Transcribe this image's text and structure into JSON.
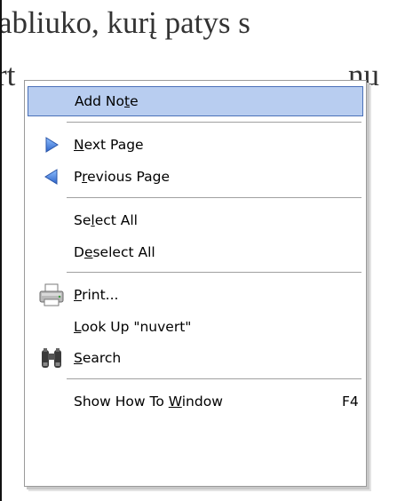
{
  "document": {
    "line1": "abliuko, kurį patys s",
    "line2_prefix": "rt",
    "line2_suffix": "nu"
  },
  "menu": {
    "items": [
      {
        "pre": "Add No",
        "u": "t",
        "post": "e",
        "shortcut": ""
      },
      {
        "pre": "",
        "u": "N",
        "post": "ext Page",
        "shortcut": ""
      },
      {
        "pre": "P",
        "u": "r",
        "post": "evious Page",
        "shortcut": ""
      },
      {
        "pre": "Se",
        "u": "l",
        "post": "ect All",
        "shortcut": ""
      },
      {
        "pre": "D",
        "u": "e",
        "post": "select All",
        "shortcut": ""
      },
      {
        "pre": "",
        "u": "P",
        "post": "rint...",
        "shortcut": ""
      },
      {
        "pre": "",
        "u": "L",
        "post": "ook Up \"nuvert\"",
        "shortcut": ""
      },
      {
        "pre": "",
        "u": "S",
        "post": "earch",
        "shortcut": ""
      },
      {
        "pre": "Show How To ",
        "u": "W",
        "post": "indow",
        "shortcut": "F4"
      }
    ],
    "icons": {
      "next_page": "play-right-icon",
      "previous_page": "play-left-icon",
      "print": "printer-icon",
      "search": "binoculars-icon"
    },
    "colors": {
      "highlight_bg": "#b8cdf0",
      "highlight_border": "#4a70b8",
      "arrow_blue": "#3d7de0"
    }
  }
}
